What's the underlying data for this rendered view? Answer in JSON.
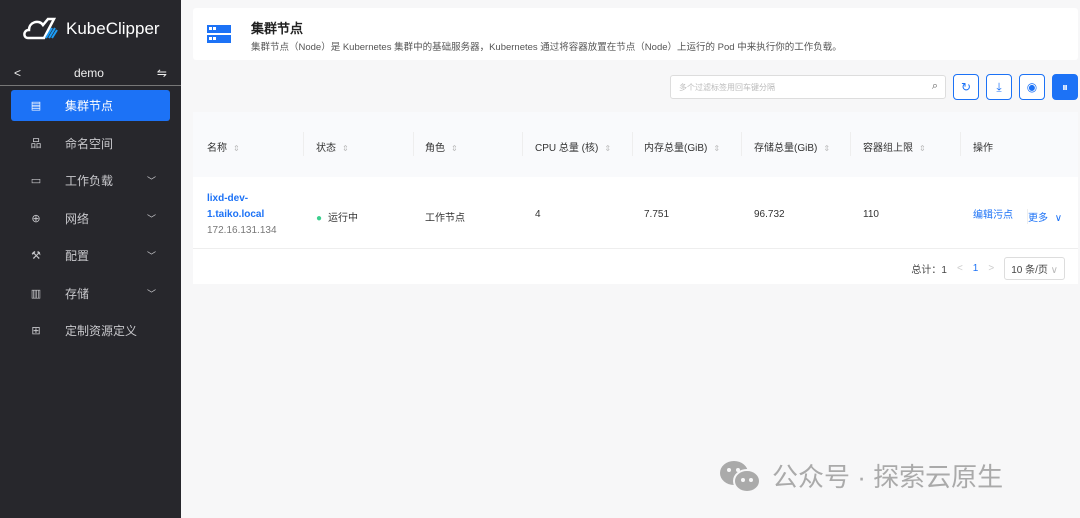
{
  "app": {
    "name": "KubeClipper",
    "project": "demo"
  },
  "sidebar": {
    "items": [
      {
        "label": "集群节点",
        "icon": "node-icon",
        "active": true,
        "expandable": false
      },
      {
        "label": "命名空间",
        "icon": "namespace-icon",
        "expandable": false
      },
      {
        "label": "工作负载",
        "icon": "monitor-icon",
        "expandable": true
      },
      {
        "label": "网络",
        "icon": "globe-icon",
        "expandable": true
      },
      {
        "label": "配置",
        "icon": "wrench-icon",
        "expandable": true
      },
      {
        "label": "存储",
        "icon": "storage-icon",
        "expandable": true
      },
      {
        "label": "定制资源定义",
        "icon": "grid-icon",
        "expandable": false
      }
    ]
  },
  "header": {
    "title": "集群节点",
    "description": "集群节点（Node）是 Kubernetes 集群中的基础服务器，Kubernetes 通过将容器放置在节点（Node）上运行的 Pod 中来执行你的工作负载。"
  },
  "search": {
    "placeholder": "多个过滤标签用回车键分隔"
  },
  "table": {
    "columns": [
      "名称",
      "状态",
      "角色",
      "CPU 总量 (核)",
      "内存总量(GiB)",
      "存储总量(GiB)",
      "容器组上限",
      "操作"
    ],
    "rows": [
      {
        "name_line1": "lixd-dev-",
        "name_line2": "1.taiko.local",
        "ip": "172.16.131.134",
        "status": "运行中",
        "role": "工作节点",
        "cpu": "4",
        "memory": "7.751",
        "storage": "96.732",
        "pods": "110",
        "action": "编辑污点",
        "more": "更多"
      }
    ]
  },
  "pagination": {
    "total_label": "总计：",
    "total": "1",
    "page": "1",
    "page_size": "10 条/页"
  },
  "watermark": "公众号 · 探索云原生",
  "colors": {
    "accent": "#1c72f6",
    "sidebar": "#27272c",
    "running": "#3ccf8e"
  }
}
